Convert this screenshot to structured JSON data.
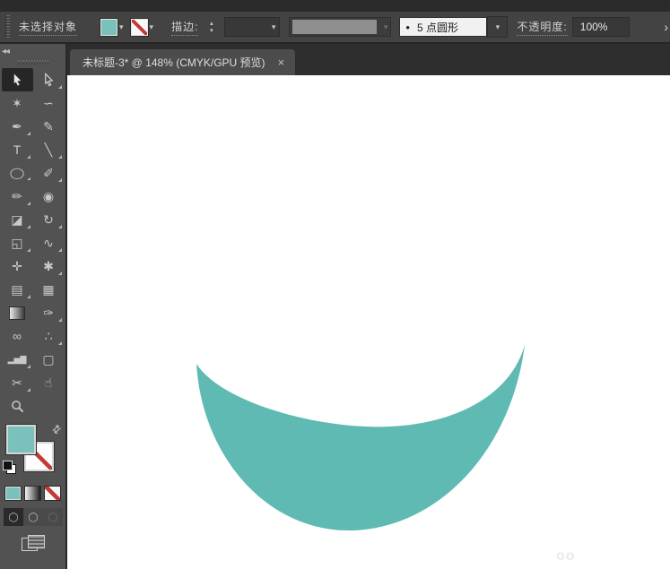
{
  "colors": {
    "teal_shape": "#5FBAB3",
    "teal_swatch": "#7AC1BC",
    "red_none": "#C23A3A"
  },
  "control_bar": {
    "selection_status": "未选择对象",
    "stroke_label": "描边:",
    "stepper_up": "▴",
    "stepper_down": "▾",
    "chevron": "▾",
    "brush_bullet": "•",
    "brush_name": "5 点圆形",
    "opacity_label": "不透明度:",
    "opacity_value": "100%",
    "overflow_chevron": "›"
  },
  "document_tab": {
    "title": "未标题-3* @ 148% (CMYK/GPU 预览)",
    "close": "×"
  },
  "toolbar": {
    "collapse_glyph": "◂◂",
    "tools": [
      {
        "name": "selection",
        "glyph": "svg:selection",
        "selected": true
      },
      {
        "name": "direct-selection",
        "glyph": "svg:direct-selection",
        "flyout": true
      },
      {
        "name": "magic-wand",
        "glyph": "✶"
      },
      {
        "name": "lasso",
        "glyph": "∽"
      },
      {
        "name": "pen",
        "glyph": "✒",
        "flyout": true
      },
      {
        "name": "curvature",
        "glyph": "✎"
      },
      {
        "name": "type",
        "glyph": "T",
        "flyout": true
      },
      {
        "name": "line-segment",
        "glyph": "╲",
        "flyout": true
      },
      {
        "name": "ellipse",
        "glyph": "◯",
        "flyout": true,
        "squash": true
      },
      {
        "name": "paintbrush",
        "glyph": "✐",
        "flyout": true
      },
      {
        "name": "pencil",
        "glyph": "✏",
        "flyout": true
      },
      {
        "name": "blob-brush",
        "glyph": "◉"
      },
      {
        "name": "eraser",
        "glyph": "◪",
        "flyout": true
      },
      {
        "name": "rotate",
        "glyph": "↻",
        "flyout": true
      },
      {
        "name": "scale",
        "glyph": "◱",
        "flyout": true
      },
      {
        "name": "width",
        "glyph": "∿",
        "flyout": true
      },
      {
        "name": "puppet-warp",
        "glyph": "✛"
      },
      {
        "name": "shape-builder",
        "glyph": "✱",
        "flyout": true
      },
      {
        "name": "perspective-grid",
        "glyph": "▤",
        "flyout": true
      },
      {
        "name": "mesh",
        "glyph": "▦"
      },
      {
        "name": "gradient",
        "glyph": "css:gradient"
      },
      {
        "name": "eyedropper",
        "glyph": "✑",
        "flyout": true
      },
      {
        "name": "blend",
        "glyph": "∞"
      },
      {
        "name": "symbol-sprayer",
        "glyph": "∴",
        "flyout": true
      },
      {
        "name": "column-graph",
        "glyph": "▂▅▇",
        "flyout": true,
        "bars": true
      },
      {
        "name": "artboard",
        "glyph": "▢"
      },
      {
        "name": "slice",
        "glyph": "✂",
        "flyout": true
      },
      {
        "name": "hand",
        "glyph": "☝"
      },
      {
        "name": "zoom",
        "glyph": "svg:zoom"
      }
    ],
    "swap_glyph": "⇄",
    "mode_glyph": "◯"
  },
  "canvas": {
    "shape": "crescent",
    "watermark": "oo"
  }
}
